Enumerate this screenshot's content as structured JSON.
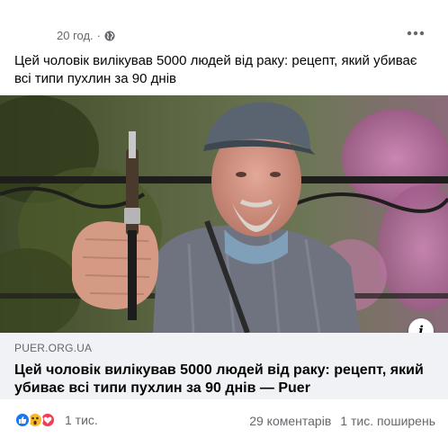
{
  "post": {
    "timestamp": "20 год.",
    "separator": "·",
    "audience_icon": "globe-icon",
    "more_icon": "more-horizontal-icon",
    "text": "Цей чоловік вилікував 5000 людей від раку: рецепт, який убиває всі типи пухлин за 90 днів"
  },
  "link_preview": {
    "domain": "PUER.ORG.UA",
    "title": "Цей чоловік вилікував 5000 людей від раку: рецепт, який убиває всі типи пухлин за 90 днів — Puer",
    "info_icon": "info-icon",
    "info_label": "i"
  },
  "engagement": {
    "reaction_icons": [
      "like-icon",
      "wow-icon",
      "love-icon"
    ],
    "reactions_count": "1 тис.",
    "comments": "29 коментарів",
    "shares": "1 тис. поширень"
  },
  "colors": {
    "text": "#050505",
    "secondary": "#65676b",
    "preview_bg": "#f0f2f5",
    "like_blue": "#1877f2",
    "wow_yellow": "#f7b928",
    "love_red": "#f33e58"
  }
}
